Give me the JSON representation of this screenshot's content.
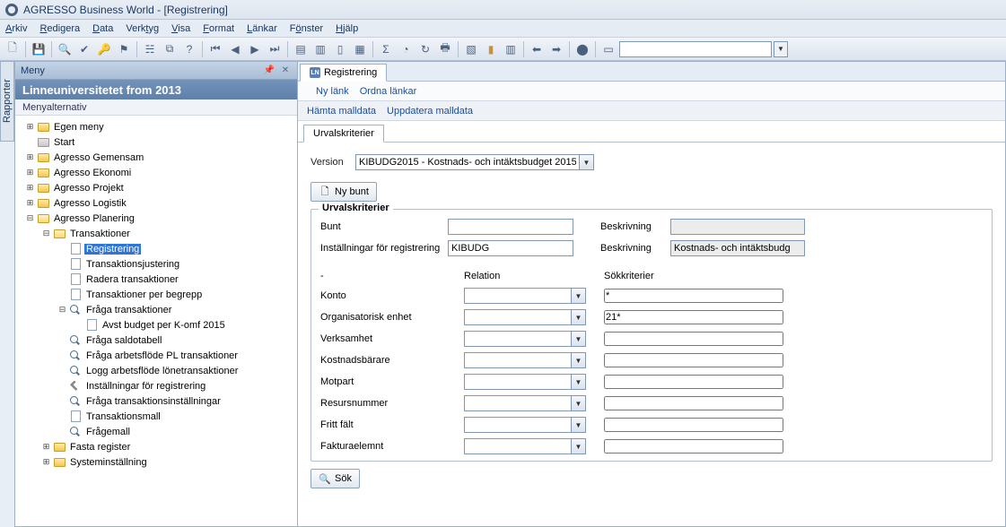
{
  "title": "AGRESSO Business World - [Registrering]",
  "menubar": [
    "Arkiv",
    "Redigera",
    "Data",
    "Verktyg",
    "Visa",
    "Format",
    "Länkar",
    "Fönster",
    "Hjälp"
  ],
  "sidetab": "Rapporter",
  "nav": {
    "header": "Meny",
    "org": "Linneuniversitetet  from 2013",
    "sub": "Menyalternativ"
  },
  "tree": [
    {
      "d": 0,
      "t": "+",
      "ico": "folder",
      "lbl": "Egen meny"
    },
    {
      "d": 0,
      "t": "",
      "ico": "folder-grey",
      "lbl": "Start"
    },
    {
      "d": 0,
      "t": "+",
      "ico": "folder",
      "lbl": "Agresso Gemensam"
    },
    {
      "d": 0,
      "t": "+",
      "ico": "folder",
      "lbl": "Agresso Ekonomi"
    },
    {
      "d": 0,
      "t": "+",
      "ico": "folder",
      "lbl": "Agresso Projekt"
    },
    {
      "d": 0,
      "t": "+",
      "ico": "folder",
      "lbl": "Agresso Logistik"
    },
    {
      "d": 0,
      "t": "-",
      "ico": "folder-open",
      "lbl": "Agresso Planering"
    },
    {
      "d": 1,
      "t": "-",
      "ico": "folder-open",
      "lbl": "Transaktioner"
    },
    {
      "d": 2,
      "t": "",
      "ico": "page",
      "lbl": "Registrering",
      "sel": true
    },
    {
      "d": 2,
      "t": "",
      "ico": "page",
      "lbl": "Transaktionsjustering"
    },
    {
      "d": 2,
      "t": "",
      "ico": "page",
      "lbl": "Radera transaktioner"
    },
    {
      "d": 2,
      "t": "",
      "ico": "page",
      "lbl": "Transaktioner per begrepp"
    },
    {
      "d": 2,
      "t": "-",
      "ico": "mag",
      "lbl": "Fråga transaktioner"
    },
    {
      "d": 3,
      "t": "",
      "ico": "page",
      "lbl": "Avst budget per K-omf 2015"
    },
    {
      "d": 2,
      "t": "",
      "ico": "mag",
      "lbl": "Fråga saldotabell"
    },
    {
      "d": 2,
      "t": "",
      "ico": "mag",
      "lbl": "Fråga arbetsflöde PL transaktioner"
    },
    {
      "d": 2,
      "t": "",
      "ico": "mag",
      "lbl": "Logg arbetsflöde lönetransaktioner"
    },
    {
      "d": 2,
      "t": "",
      "ico": "wrench",
      "lbl": "Inställningar för registrering"
    },
    {
      "d": 2,
      "t": "",
      "ico": "mag",
      "lbl": "Fråga transaktionsinställningar"
    },
    {
      "d": 2,
      "t": "",
      "ico": "page",
      "lbl": "Transaktionsmall"
    },
    {
      "d": 2,
      "t": "",
      "ico": "mag",
      "lbl": "Frågemall"
    },
    {
      "d": 1,
      "t": "+",
      "ico": "folder",
      "lbl": "Fasta register"
    },
    {
      "d": 1,
      "t": "+",
      "ico": "folder",
      "lbl": "Systeminställning"
    }
  ],
  "content": {
    "tab": "Registrering",
    "links": [
      "Ny länk",
      "Ordna länkar"
    ],
    "actions": [
      "Hämta malldata",
      "Uppdatera malldata"
    ],
    "innertab": "Urvalskriterier",
    "versionLabel": "Version",
    "versionValue": "KIBUDG2015 - Kostnads- och intäktsbudget 2015",
    "nybunt": "Ny bunt",
    "groupTitle": "Urvalskriterier",
    "fields": {
      "buntL": "Bunt",
      "buntV": "",
      "beskr1L": "Beskrivning",
      "beskr1V": "",
      "instL": "Inställningar för registrering",
      "instV": "KIBUDG",
      "beskr2L": "Beskrivning",
      "beskr2V": "Kostnads- och intäktsbudg"
    },
    "cols": {
      "c1": "-",
      "c2": "Relation",
      "c3": "Sökkriterier"
    },
    "rows": [
      {
        "l": "Konto",
        "r": "",
        "s": "*"
      },
      {
        "l": "Organisatorisk enhet",
        "r": "",
        "s": "21*"
      },
      {
        "l": "Verksamhet",
        "r": "",
        "s": ""
      },
      {
        "l": "Kostnadsbärare",
        "r": "",
        "s": ""
      },
      {
        "l": "Motpart",
        "r": "",
        "s": ""
      },
      {
        "l": "Resursnummer",
        "r": "",
        "s": ""
      },
      {
        "l": "Fritt fält",
        "r": "",
        "s": ""
      },
      {
        "l": "Fakturaelemnt",
        "r": "",
        "s": ""
      }
    ],
    "sok": "Sök"
  }
}
